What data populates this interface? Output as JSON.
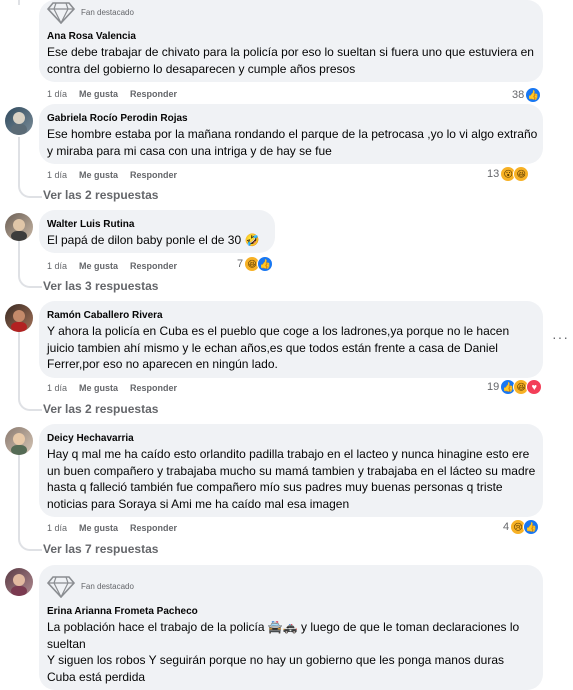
{
  "comments": [
    {
      "fan_label": "Fan destacado",
      "author": "Ana Rosa Valencia",
      "text": "Ese debe trabajar de chivato para la policía por eso lo sueltan si fuera uno que estuviera en contra del gobierno lo desaparecen y cumple años presos",
      "time": "1 día",
      "like": "Me gusta",
      "reply": "Responder",
      "reaction_count": "38"
    },
    {
      "author": "Gabriela Rocío Perodin Rojas",
      "text": "Ese hombre estaba por la mañana rondando el parque de la petrocasa ,yo lo vi algo extraño y miraba para mi casa con una intriga y de hay se fue",
      "time": "1 día",
      "like": "Me gusta",
      "reply": "Responder",
      "reaction_count": "13",
      "replies": "Ver las 2 respuestas"
    },
    {
      "author": "Walter Luis Rutina",
      "text": "El papá de dilon baby ponle el de 30 🤣",
      "time": "1 día",
      "like": "Me gusta",
      "reply": "Responder",
      "reaction_count": "7",
      "replies": "Ver las 3 respuestas"
    },
    {
      "author": "Ramón Caballero Rivera",
      "text": "Y ahora la policía en Cuba es el pueblo que coge a los ladrones,ya porque no le hacen juicio tambien ahí mismo y le echan años,es que todos están frente a casa de Daniel Ferrer,por eso no aparecen en ningún lado.",
      "time": "1 día",
      "like": "Me gusta",
      "reply": "Responder",
      "reaction_count": "19",
      "replies": "Ver las 2 respuestas"
    },
    {
      "author": "Deicy Hechavarria",
      "text": "Hay q mal me ha caído esto orlandito padilla trabajo en el lacteo y nunca hinagine esto ere un buen compañero y trabajaba mucho su mamá tambien y trabajaba en el lácteo su madre hasta q falleció también fue compañero mío sus padres muy buenas personas q triste noticias para Soraya si Ami me ha caído mal esa imagen",
      "time": "1 día",
      "like": "Me gusta",
      "reply": "Responder",
      "reaction_count": "4",
      "replies": "Ver las 7 respuestas"
    },
    {
      "fan_label": "Fan destacado",
      "author": "Erina Arianna Frometa Pacheco",
      "text_lines": [
        "La población hace el trabajo de la policía 🚔🚓 y luego de que le toman declaraciones lo sueltan",
        "Y siguen los robos Y seguirán porque no hay un gobierno que les ponga manos duras",
        "Cuba está perdida"
      ]
    }
  ],
  "more_options": "···",
  "colors": {
    "like": "#1877f2",
    "love": "#f33e58",
    "bubble": "#f0f2f5"
  }
}
